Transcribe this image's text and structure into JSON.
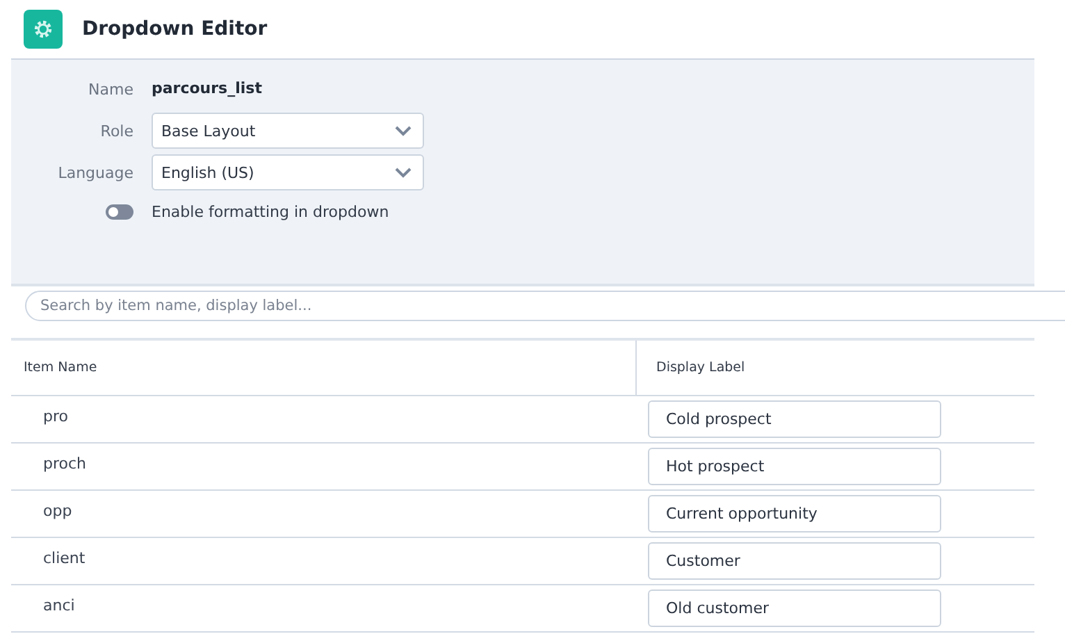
{
  "header": {
    "title": "Dropdown Editor"
  },
  "form": {
    "name_label": "Name",
    "name_value": "parcours_list",
    "fields": [
      {
        "label": "Role",
        "value": "Base Layout"
      },
      {
        "label": "Language",
        "value": "English (US)"
      }
    ],
    "toggle": {
      "label": "Enable formatting in dropdown",
      "on": false
    }
  },
  "search": {
    "placeholder": "Search by item name, display label..."
  },
  "table": {
    "columns": [
      "Item Name",
      "Display Label"
    ],
    "rows": [
      {
        "item": "pro",
        "label": "Cold prospect"
      },
      {
        "item": "proch",
        "label": "Hot prospect"
      },
      {
        "item": "opp",
        "label": "Current opportunity"
      },
      {
        "item": "client",
        "label": "Customer"
      },
      {
        "item": "anci",
        "label": "Old customer"
      }
    ]
  }
}
